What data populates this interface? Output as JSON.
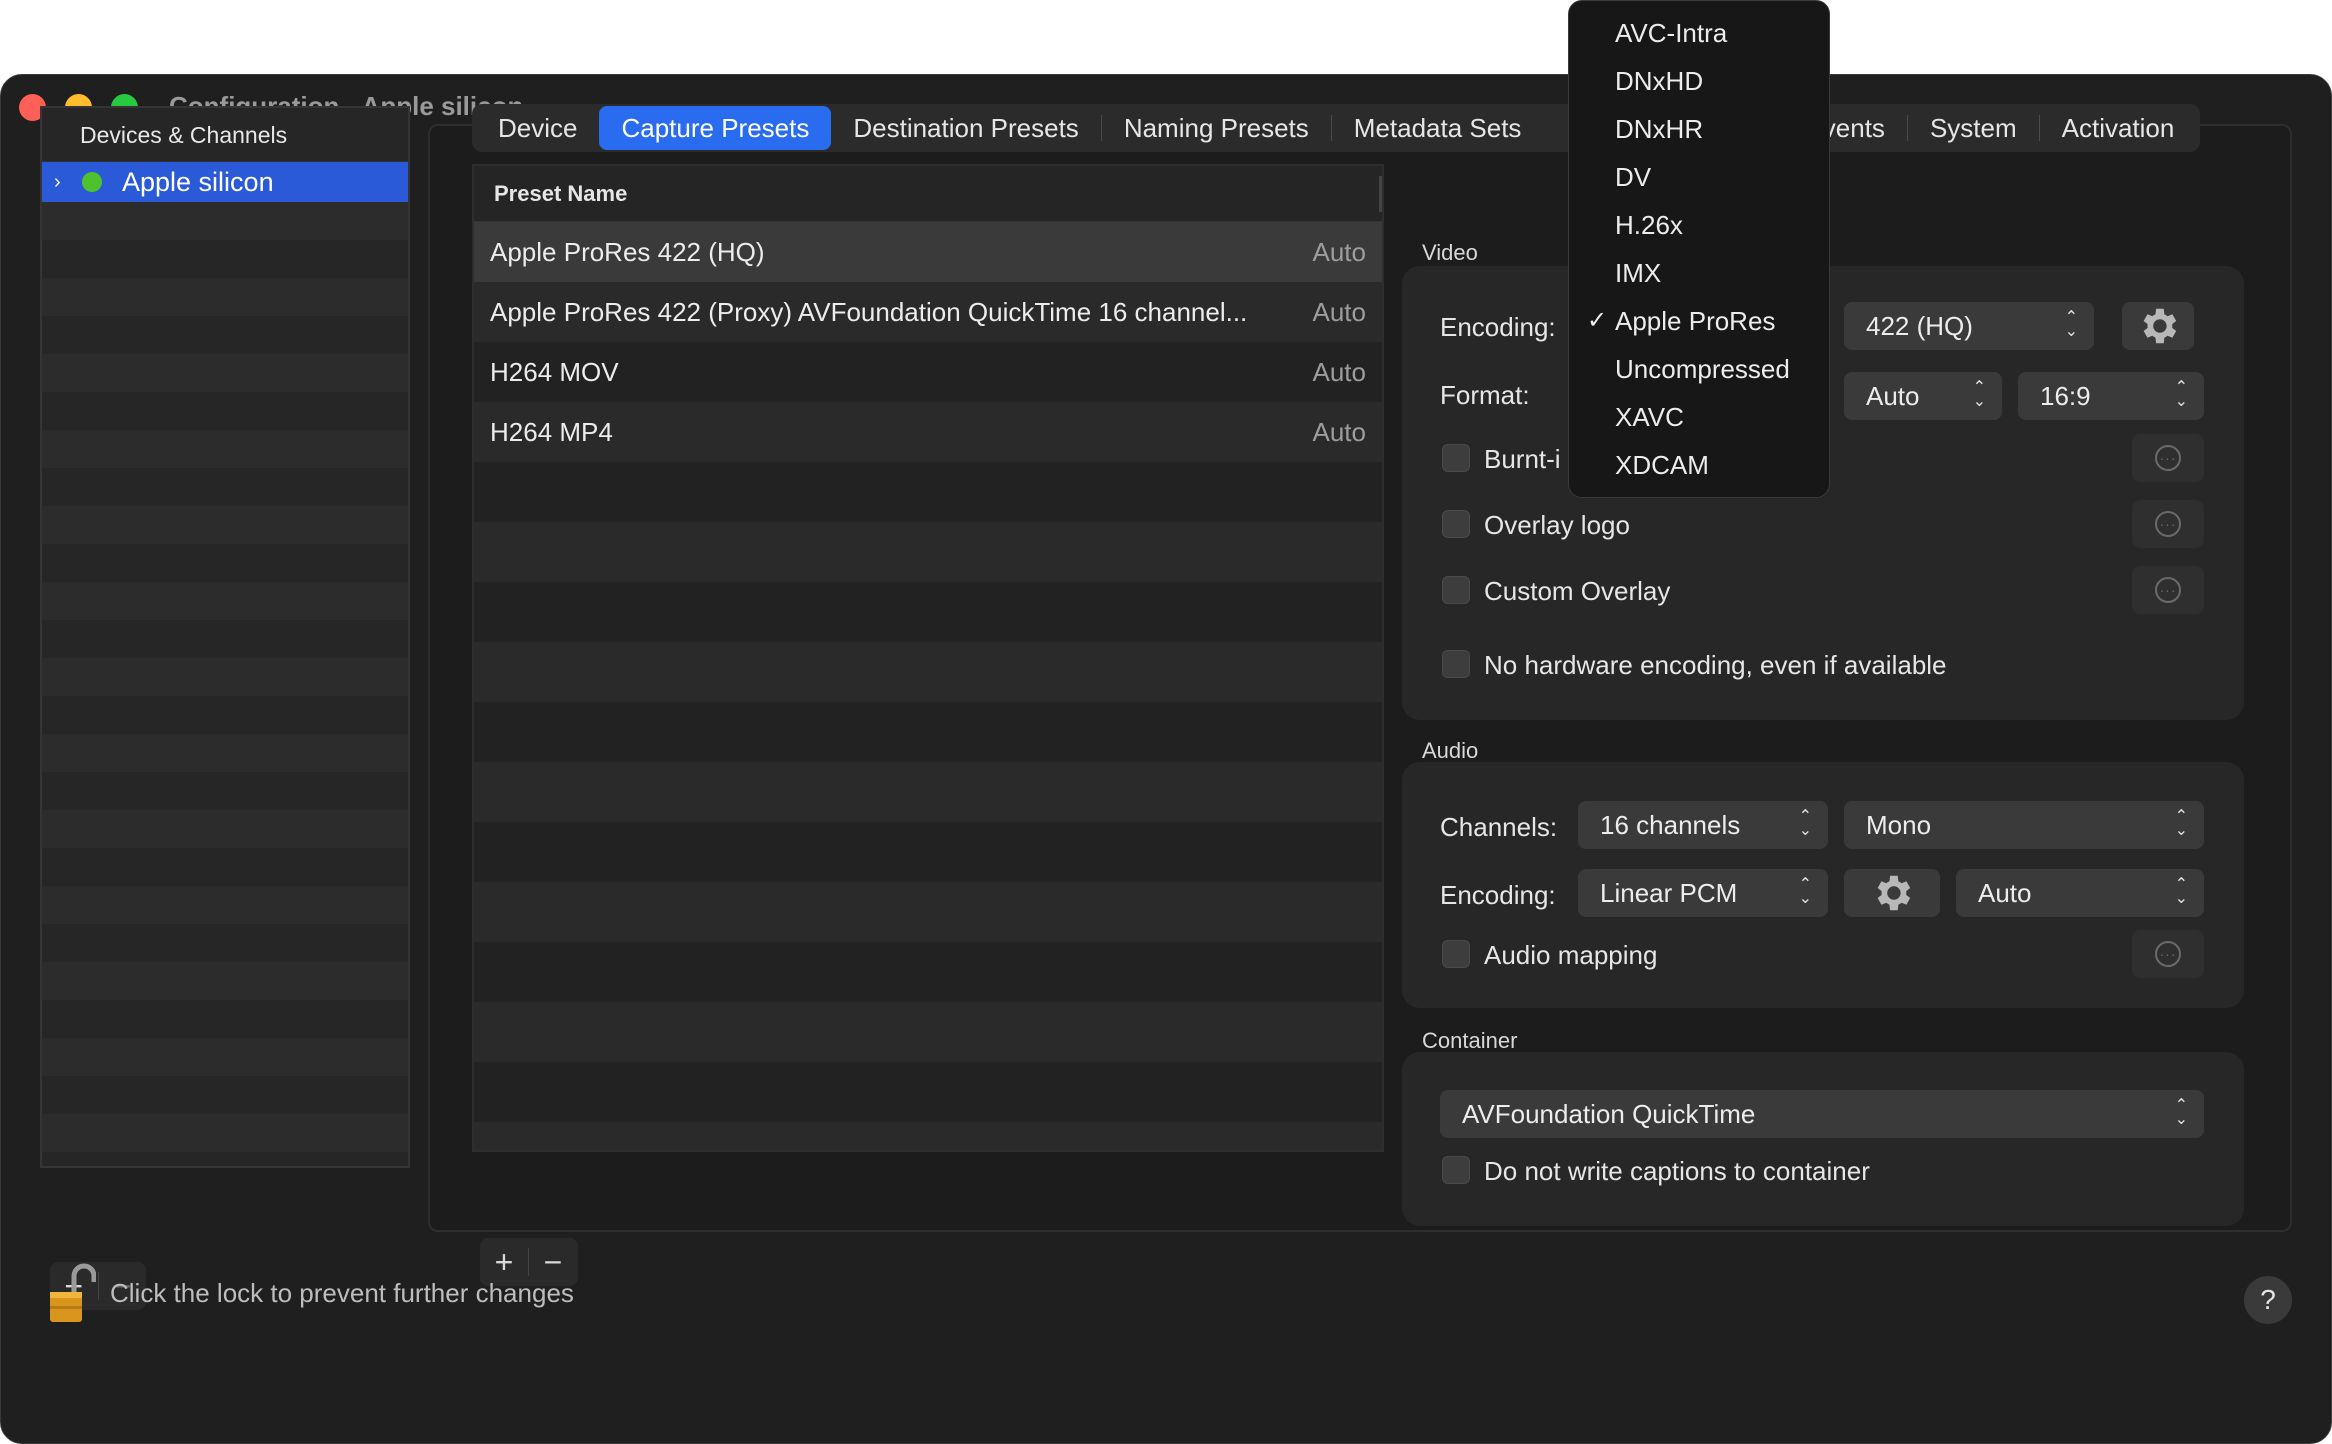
{
  "window": {
    "title": "Configuration - Apple silicon"
  },
  "sidebar": {
    "header": "Devices & Channels",
    "selected_item": "Apple silicon",
    "add_label": "+",
    "remove_label": "−"
  },
  "tabs": [
    {
      "label": "Device"
    },
    {
      "label": "Capture Presets"
    },
    {
      "label": "Destination Presets"
    },
    {
      "label": "Naming Presets"
    },
    {
      "label": "Metadata Sets"
    },
    {
      "label": "Events"
    },
    {
      "label": "System"
    },
    {
      "label": "Activation"
    }
  ],
  "presets": {
    "column_header": "Preset Name",
    "rows": [
      {
        "name": "Apple ProRes 422 (HQ)",
        "value": "Auto"
      },
      {
        "name": "Apple ProRes 422 (Proxy) AVFoundation QuickTime 16 channel...",
        "value": "Auto"
      },
      {
        "name": "H264 MOV",
        "value": "Auto"
      },
      {
        "name": "H264 MP4",
        "value": "Auto"
      }
    ],
    "add_label": "+",
    "remove_label": "−"
  },
  "video": {
    "section_label": "Video",
    "encoding_label": "Encoding:",
    "encoding_profile": "422 (HQ)",
    "format_label": "Format:",
    "format_value": "Auto",
    "aspect_value": "16:9",
    "burnt_in_label": "Burnt-i",
    "overlay_logo_label": "Overlay logo",
    "custom_overlay_label": "Custom Overlay",
    "no_hw_label": "No hardware encoding, even if available"
  },
  "audio": {
    "section_label": "Audio",
    "channels_label": "Channels:",
    "channels_value": "16 channels",
    "channel_mode": "Mono",
    "encoding_label": "Encoding:",
    "encoding_value": "Linear PCM",
    "rate_value": "Auto",
    "mapping_label": "Audio mapping"
  },
  "container": {
    "section_label": "Container",
    "value": "AVFoundation QuickTime",
    "captions_label": "Do not write captions to container"
  },
  "encoding_menu": {
    "items": [
      "AVC-Intra",
      "DNxHD",
      "DNxHR",
      "DV",
      "H.26x",
      "IMX",
      "Apple ProRes",
      "Uncompressed",
      "XAVC",
      "XDCAM"
    ],
    "checked": "Apple ProRes",
    "check_mark": "✓"
  },
  "footer": {
    "lock_text": "Click the lock to prevent further changes",
    "help_label": "?"
  }
}
